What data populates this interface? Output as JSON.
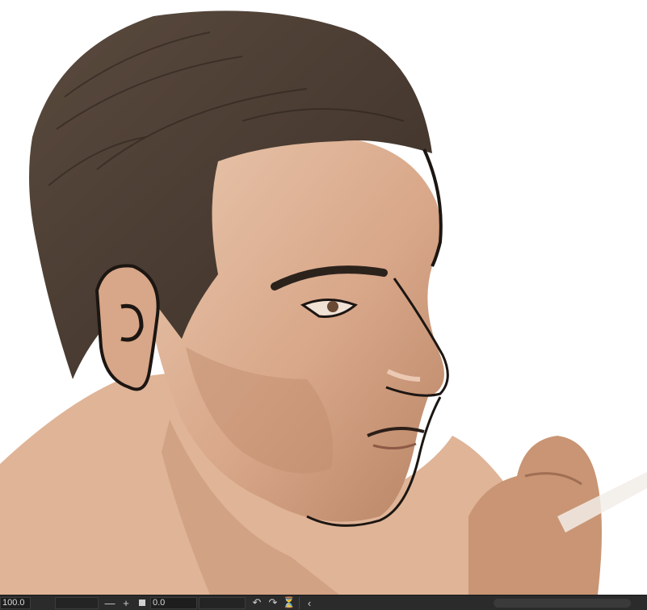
{
  "statusbar": {
    "zoom_value": "100.0",
    "rotation_value": "0.0",
    "icons": {
      "zoom_out": "minus-icon",
      "zoom_in": "plus-icon",
      "fit": "square-icon",
      "rotate_left": "rotate-left-icon",
      "rotate_right": "rotate-right-icon",
      "reset_rotation": "reset-rotation-icon",
      "collapse": "chevron-left-icon"
    }
  },
  "colors": {
    "canvas_bg": "#ffffff",
    "statusbar_bg": "#2b2b2b",
    "skin": "#dcae8f",
    "hair": "#4a3c31",
    "line": "#1c1612"
  }
}
